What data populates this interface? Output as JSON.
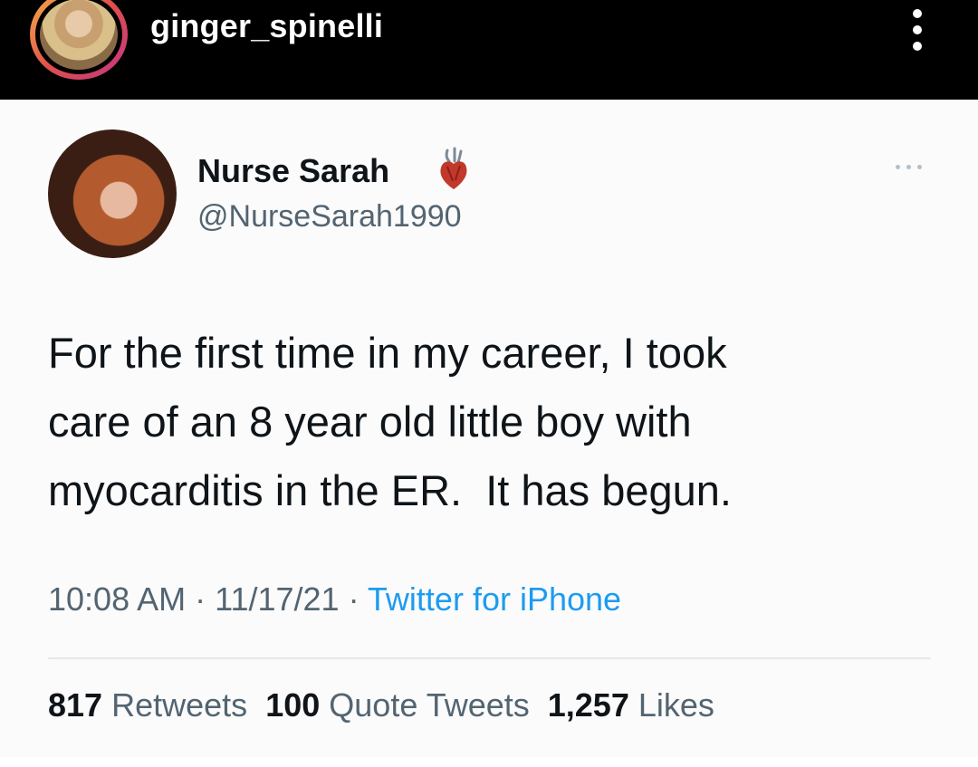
{
  "instagram": {
    "username": "ginger_spinelli",
    "avatar_icon": "profile-photo",
    "more_icon": "vertical-ellipsis-icon"
  },
  "tweet": {
    "author_name": "Nurse Sarah",
    "author_emoji_icon": "anatomical-heart-icon",
    "handle": "@NurseSarah1990",
    "text_lines": [
      "For the first time in my career, I took",
      "care of an 8 year old little boy with",
      "myocarditis in the ER.  It has begun."
    ],
    "time": "10:08 AM",
    "date": "11/17/21",
    "source": "Twitter for iPhone",
    "retweets_count": "817",
    "retweets_label": "Retweets",
    "quotes_count": "100",
    "quotes_label": "Quote Tweets",
    "likes_count": "1,257",
    "likes_label": "Likes"
  },
  "colors": {
    "instagram_bar": "#000000",
    "text_primary": "#0f1419",
    "text_secondary": "#536471",
    "link_blue": "#1d9bf0"
  }
}
